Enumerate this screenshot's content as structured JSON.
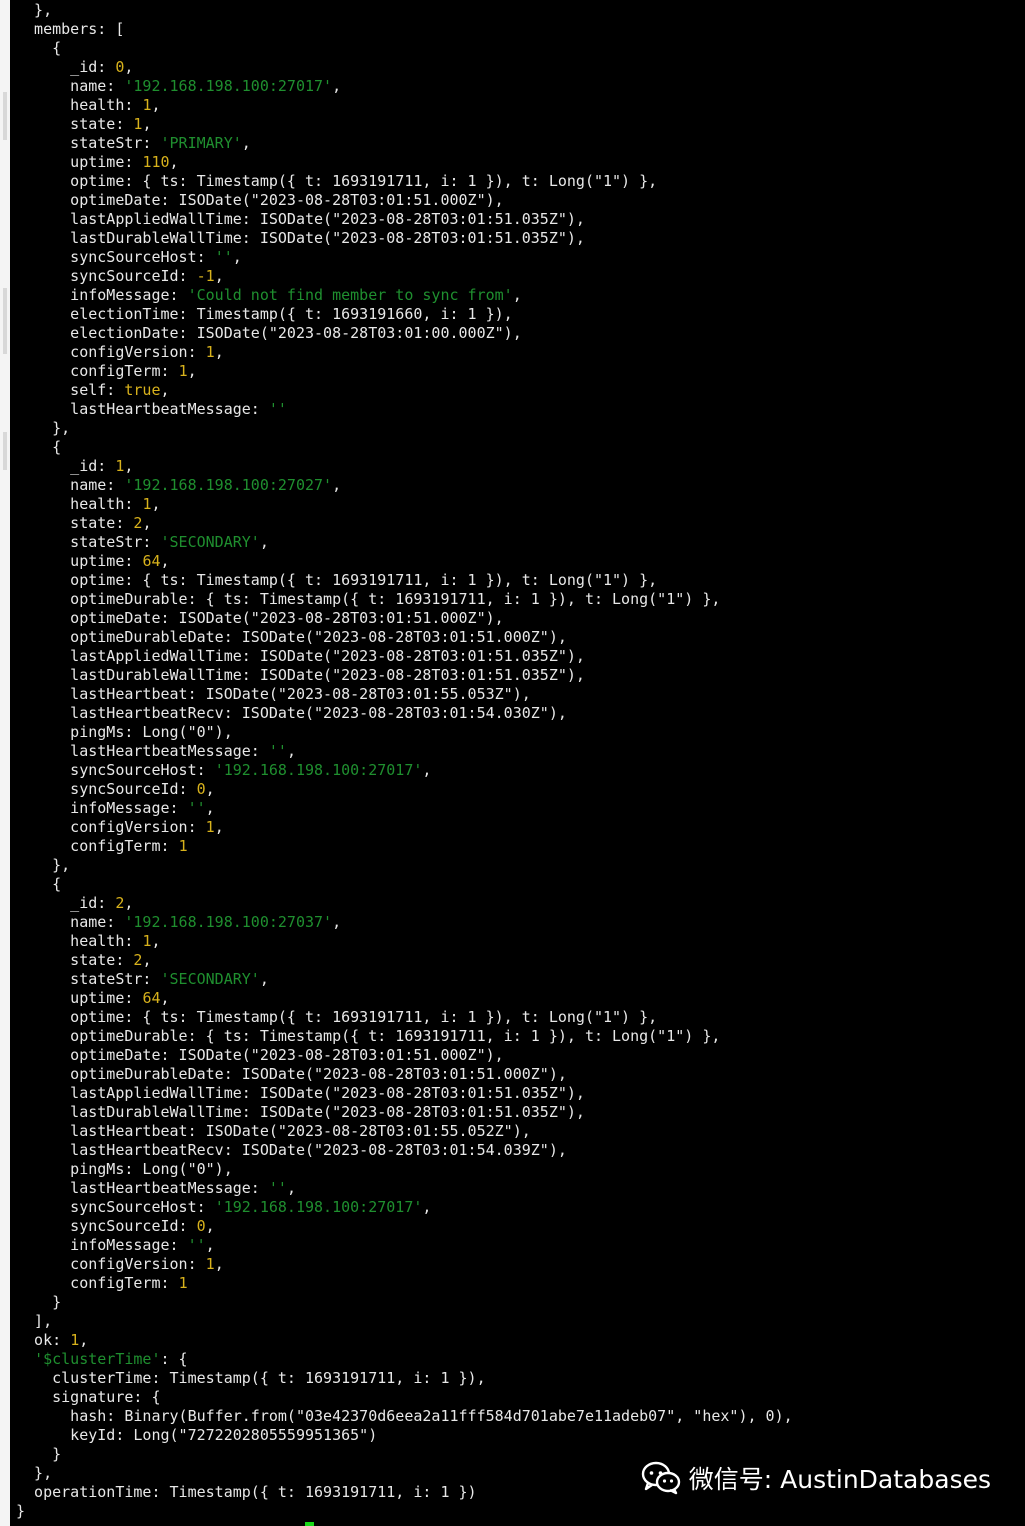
{
  "watermark": {
    "icon": "wechat-icon",
    "text": "微信号: AustinDatabases"
  },
  "colors": {
    "background": "#000000",
    "text": "#e8e8e8",
    "string": "#1f8f2f",
    "number": "#d8b21c",
    "cursor": "#18d818"
  },
  "lines": [
    [
      {
        "t": "  },",
        "c": "p"
      }
    ],
    [
      {
        "t": "  members: [",
        "c": "p"
      }
    ],
    [
      {
        "t": "    {",
        "c": "p"
      }
    ],
    [
      {
        "t": "      _id: ",
        "c": "p"
      },
      {
        "t": "0",
        "c": "n"
      },
      {
        "t": ",",
        "c": "p"
      }
    ],
    [
      {
        "t": "      name: ",
        "c": "p"
      },
      {
        "t": "'192.168.198.100:27017'",
        "c": "s"
      },
      {
        "t": ",",
        "c": "p"
      }
    ],
    [
      {
        "t": "      health: ",
        "c": "p"
      },
      {
        "t": "1",
        "c": "n"
      },
      {
        "t": ",",
        "c": "p"
      }
    ],
    [
      {
        "t": "      state: ",
        "c": "p"
      },
      {
        "t": "1",
        "c": "n"
      },
      {
        "t": ",",
        "c": "p"
      }
    ],
    [
      {
        "t": "      stateStr: ",
        "c": "p"
      },
      {
        "t": "'PRIMARY'",
        "c": "s"
      },
      {
        "t": ",",
        "c": "p"
      }
    ],
    [
      {
        "t": "      uptime: ",
        "c": "p"
      },
      {
        "t": "110",
        "c": "n"
      },
      {
        "t": ",",
        "c": "p"
      }
    ],
    [
      {
        "t": "      optime: { ts: Timestamp({ t: 1693191711, i: 1 }), t: Long(\"1\") },",
        "c": "p"
      }
    ],
    [
      {
        "t": "      optimeDate: ISODate(\"2023-08-28T03:01:51.000Z\"),",
        "c": "p"
      }
    ],
    [
      {
        "t": "      lastAppliedWallTime: ISODate(\"2023-08-28T03:01:51.035Z\"),",
        "c": "p"
      }
    ],
    [
      {
        "t": "      lastDurableWallTime: ISODate(\"2023-08-28T03:01:51.035Z\"),",
        "c": "p"
      }
    ],
    [
      {
        "t": "      syncSourceHost: ",
        "c": "p"
      },
      {
        "t": "''",
        "c": "s"
      },
      {
        "t": ",",
        "c": "p"
      }
    ],
    [
      {
        "t": "      syncSourceId: ",
        "c": "p"
      },
      {
        "t": "-1",
        "c": "n"
      },
      {
        "t": ",",
        "c": "p"
      }
    ],
    [
      {
        "t": "      infoMessage: ",
        "c": "p"
      },
      {
        "t": "'Could not find member to sync from'",
        "c": "s"
      },
      {
        "t": ",",
        "c": "p"
      }
    ],
    [
      {
        "t": "      electionTime: Timestamp({ t: 1693191660, i: 1 }),",
        "c": "p"
      }
    ],
    [
      {
        "t": "      electionDate: ISODate(\"2023-08-28T03:01:00.000Z\"),",
        "c": "p"
      }
    ],
    [
      {
        "t": "      configVersion: ",
        "c": "p"
      },
      {
        "t": "1",
        "c": "n"
      },
      {
        "t": ",",
        "c": "p"
      }
    ],
    [
      {
        "t": "      configTerm: ",
        "c": "p"
      },
      {
        "t": "1",
        "c": "n"
      },
      {
        "t": ",",
        "c": "p"
      }
    ],
    [
      {
        "t": "      self: ",
        "c": "p"
      },
      {
        "t": "true",
        "c": "n"
      },
      {
        "t": ",",
        "c": "p"
      }
    ],
    [
      {
        "t": "      lastHeartbeatMessage: ",
        "c": "p"
      },
      {
        "t": "''",
        "c": "s"
      }
    ],
    [
      {
        "t": "    },",
        "c": "p"
      }
    ],
    [
      {
        "t": "    {",
        "c": "p"
      }
    ],
    [
      {
        "t": "      _id: ",
        "c": "p"
      },
      {
        "t": "1",
        "c": "n"
      },
      {
        "t": ",",
        "c": "p"
      }
    ],
    [
      {
        "t": "      name: ",
        "c": "p"
      },
      {
        "t": "'192.168.198.100:27027'",
        "c": "s"
      },
      {
        "t": ",",
        "c": "p"
      }
    ],
    [
      {
        "t": "      health: ",
        "c": "p"
      },
      {
        "t": "1",
        "c": "n"
      },
      {
        "t": ",",
        "c": "p"
      }
    ],
    [
      {
        "t": "      state: ",
        "c": "p"
      },
      {
        "t": "2",
        "c": "n"
      },
      {
        "t": ",",
        "c": "p"
      }
    ],
    [
      {
        "t": "      stateStr: ",
        "c": "p"
      },
      {
        "t": "'SECONDARY'",
        "c": "s"
      },
      {
        "t": ",",
        "c": "p"
      }
    ],
    [
      {
        "t": "      uptime: ",
        "c": "p"
      },
      {
        "t": "64",
        "c": "n"
      },
      {
        "t": ",",
        "c": "p"
      }
    ],
    [
      {
        "t": "      optime: { ts: Timestamp({ t: 1693191711, i: 1 }), t: Long(\"1\") },",
        "c": "p"
      }
    ],
    [
      {
        "t": "      optimeDurable: { ts: Timestamp({ t: 1693191711, i: 1 }), t: Long(\"1\") },",
        "c": "p"
      }
    ],
    [
      {
        "t": "      optimeDate: ISODate(\"2023-08-28T03:01:51.000Z\"),",
        "c": "p"
      }
    ],
    [
      {
        "t": "      optimeDurableDate: ISODate(\"2023-08-28T03:01:51.000Z\"),",
        "c": "p"
      }
    ],
    [
      {
        "t": "      lastAppliedWallTime: ISODate(\"2023-08-28T03:01:51.035Z\"),",
        "c": "p"
      }
    ],
    [
      {
        "t": "      lastDurableWallTime: ISODate(\"2023-08-28T03:01:51.035Z\"),",
        "c": "p"
      }
    ],
    [
      {
        "t": "      lastHeartbeat: ISODate(\"2023-08-28T03:01:55.053Z\"),",
        "c": "p"
      }
    ],
    [
      {
        "t": "      lastHeartbeatRecv: ISODate(\"2023-08-28T03:01:54.030Z\"),",
        "c": "p"
      }
    ],
    [
      {
        "t": "      pingMs: Long(\"0\"),",
        "c": "p"
      }
    ],
    [
      {
        "t": "      lastHeartbeatMessage: ",
        "c": "p"
      },
      {
        "t": "''",
        "c": "s"
      },
      {
        "t": ",",
        "c": "p"
      }
    ],
    [
      {
        "t": "      syncSourceHost: ",
        "c": "p"
      },
      {
        "t": "'192.168.198.100:27017'",
        "c": "s"
      },
      {
        "t": ",",
        "c": "p"
      }
    ],
    [
      {
        "t": "      syncSourceId: ",
        "c": "p"
      },
      {
        "t": "0",
        "c": "n"
      },
      {
        "t": ",",
        "c": "p"
      }
    ],
    [
      {
        "t": "      infoMessage: ",
        "c": "p"
      },
      {
        "t": "''",
        "c": "s"
      },
      {
        "t": ",",
        "c": "p"
      }
    ],
    [
      {
        "t": "      configVersion: ",
        "c": "p"
      },
      {
        "t": "1",
        "c": "n"
      },
      {
        "t": ",",
        "c": "p"
      }
    ],
    [
      {
        "t": "      configTerm: ",
        "c": "p"
      },
      {
        "t": "1",
        "c": "n"
      }
    ],
    [
      {
        "t": "    },",
        "c": "p"
      }
    ],
    [
      {
        "t": "    {",
        "c": "p"
      }
    ],
    [
      {
        "t": "      _id: ",
        "c": "p"
      },
      {
        "t": "2",
        "c": "n"
      },
      {
        "t": ",",
        "c": "p"
      }
    ],
    [
      {
        "t": "      name: ",
        "c": "p"
      },
      {
        "t": "'192.168.198.100:27037'",
        "c": "s"
      },
      {
        "t": ",",
        "c": "p"
      }
    ],
    [
      {
        "t": "      health: ",
        "c": "p"
      },
      {
        "t": "1",
        "c": "n"
      },
      {
        "t": ",",
        "c": "p"
      }
    ],
    [
      {
        "t": "      state: ",
        "c": "p"
      },
      {
        "t": "2",
        "c": "n"
      },
      {
        "t": ",",
        "c": "p"
      }
    ],
    [
      {
        "t": "      stateStr: ",
        "c": "p"
      },
      {
        "t": "'SECONDARY'",
        "c": "s"
      },
      {
        "t": ",",
        "c": "p"
      }
    ],
    [
      {
        "t": "      uptime: ",
        "c": "p"
      },
      {
        "t": "64",
        "c": "n"
      },
      {
        "t": ",",
        "c": "p"
      }
    ],
    [
      {
        "t": "      optime: { ts: Timestamp({ t: 1693191711, i: 1 }), t: Long(\"1\") },",
        "c": "p"
      }
    ],
    [
      {
        "t": "      optimeDurable: { ts: Timestamp({ t: 1693191711, i: 1 }), t: Long(\"1\") },",
        "c": "p"
      }
    ],
    [
      {
        "t": "      optimeDate: ISODate(\"2023-08-28T03:01:51.000Z\"),",
        "c": "p"
      }
    ],
    [
      {
        "t": "      optimeDurableDate: ISODate(\"2023-08-28T03:01:51.000Z\"),",
        "c": "p"
      }
    ],
    [
      {
        "t": "      lastAppliedWallTime: ISODate(\"2023-08-28T03:01:51.035Z\"),",
        "c": "p"
      }
    ],
    [
      {
        "t": "      lastDurableWallTime: ISODate(\"2023-08-28T03:01:51.035Z\"),",
        "c": "p"
      }
    ],
    [
      {
        "t": "      lastHeartbeat: ISODate(\"2023-08-28T03:01:55.052Z\"),",
        "c": "p"
      }
    ],
    [
      {
        "t": "      lastHeartbeatRecv: ISODate(\"2023-08-28T03:01:54.039Z\"),",
        "c": "p"
      }
    ],
    [
      {
        "t": "      pingMs: Long(\"0\"),",
        "c": "p"
      }
    ],
    [
      {
        "t": "      lastHeartbeatMessage: ",
        "c": "p"
      },
      {
        "t": "''",
        "c": "s"
      },
      {
        "t": ",",
        "c": "p"
      }
    ],
    [
      {
        "t": "      syncSourceHost: ",
        "c": "p"
      },
      {
        "t": "'192.168.198.100:27017'",
        "c": "s"
      },
      {
        "t": ",",
        "c": "p"
      }
    ],
    [
      {
        "t": "      syncSourceId: ",
        "c": "p"
      },
      {
        "t": "0",
        "c": "n"
      },
      {
        "t": ",",
        "c": "p"
      }
    ],
    [
      {
        "t": "      infoMessage: ",
        "c": "p"
      },
      {
        "t": "''",
        "c": "s"
      },
      {
        "t": ",",
        "c": "p"
      }
    ],
    [
      {
        "t": "      configVersion: ",
        "c": "p"
      },
      {
        "t": "1",
        "c": "n"
      },
      {
        "t": ",",
        "c": "p"
      }
    ],
    [
      {
        "t": "      configTerm: ",
        "c": "p"
      },
      {
        "t": "1",
        "c": "n"
      }
    ],
    [
      {
        "t": "    }",
        "c": "p"
      }
    ],
    [
      {
        "t": "  ],",
        "c": "p"
      }
    ],
    [
      {
        "t": "  ok: ",
        "c": "p"
      },
      {
        "t": "1",
        "c": "n"
      },
      {
        "t": ",",
        "c": "p"
      }
    ],
    [
      {
        "t": "  ",
        "c": "p"
      },
      {
        "t": "'$clusterTime'",
        "c": "s"
      },
      {
        "t": ": {",
        "c": "p"
      }
    ],
    [
      {
        "t": "    clusterTime: Timestamp({ t: 1693191711, i: 1 }),",
        "c": "p"
      }
    ],
    [
      {
        "t": "    signature: {",
        "c": "p"
      }
    ],
    [
      {
        "t": "      hash: Binary(Buffer.from(\"03e42370d6eea2a11fff584d701abe7e11adeb07\", \"hex\"), 0),",
        "c": "p"
      }
    ],
    [
      {
        "t": "      keyId: Long(\"7272202805559951365\")",
        "c": "p"
      }
    ],
    [
      {
        "t": "    }",
        "c": "p"
      }
    ],
    [
      {
        "t": "  },",
        "c": "p"
      }
    ],
    [
      {
        "t": "  operationTime: Timestamp({ t: 1693191711, i: 1 })",
        "c": "p"
      }
    ],
    [
      {
        "t": "}",
        "c": "p"
      }
    ]
  ]
}
